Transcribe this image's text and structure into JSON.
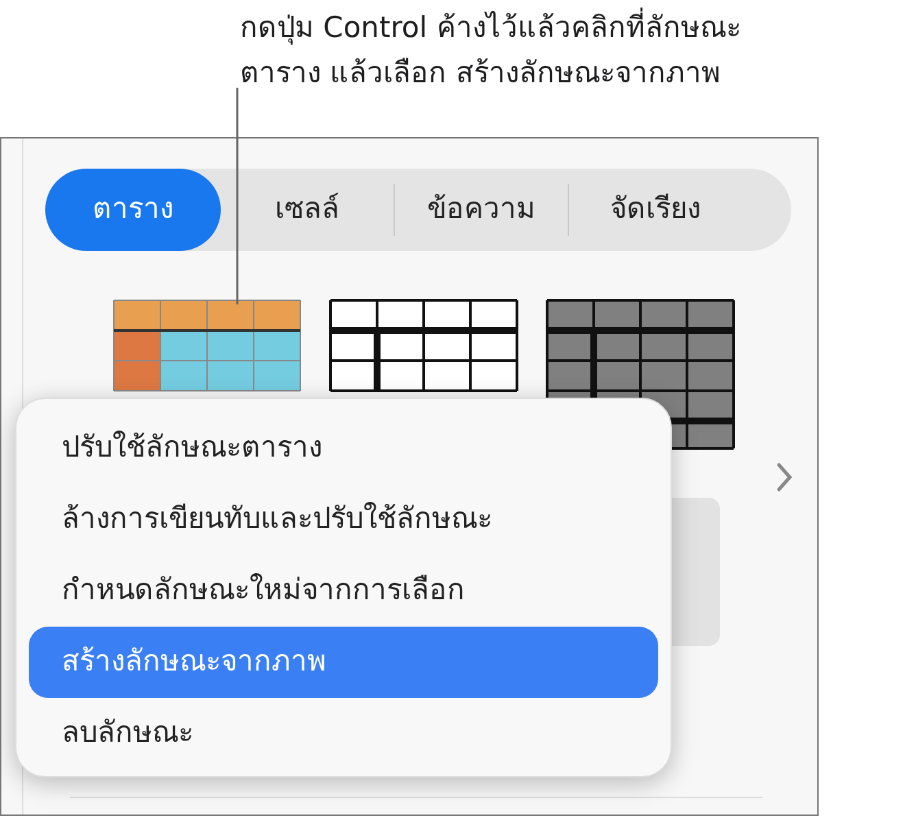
{
  "callout": {
    "lines": [
      "กดปุ่ม Control ค้างไว้แล้วคลิกที่ลักษณะ",
      "ตาราง แล้วเลือก สร้างลักษณะจากภาพ"
    ]
  },
  "tabs": [
    {
      "label": "ตาราง",
      "selected": true
    },
    {
      "label": "เซลล์",
      "selected": false
    },
    {
      "label": "ข้อความ",
      "selected": false
    },
    {
      "label": "จัดเรียง",
      "selected": false
    }
  ],
  "table_styles": [
    {
      "kind": "orange"
    },
    {
      "kind": "outline"
    },
    {
      "kind": "dark"
    }
  ],
  "context_menu": {
    "items": [
      {
        "label": "ปรับใช้ลักษณะตาราง",
        "selected": false
      },
      {
        "label": "ล้างการเขียนทับและปรับใช้ลักษณะ",
        "selected": false
      },
      {
        "label": "กำหนดลักษณะใหม่จากการเลือก",
        "selected": false
      },
      {
        "label": "สร้างลักษณะจากภาพ",
        "selected": true
      },
      {
        "label": "ลบลักษณะ",
        "selected": false
      }
    ]
  }
}
